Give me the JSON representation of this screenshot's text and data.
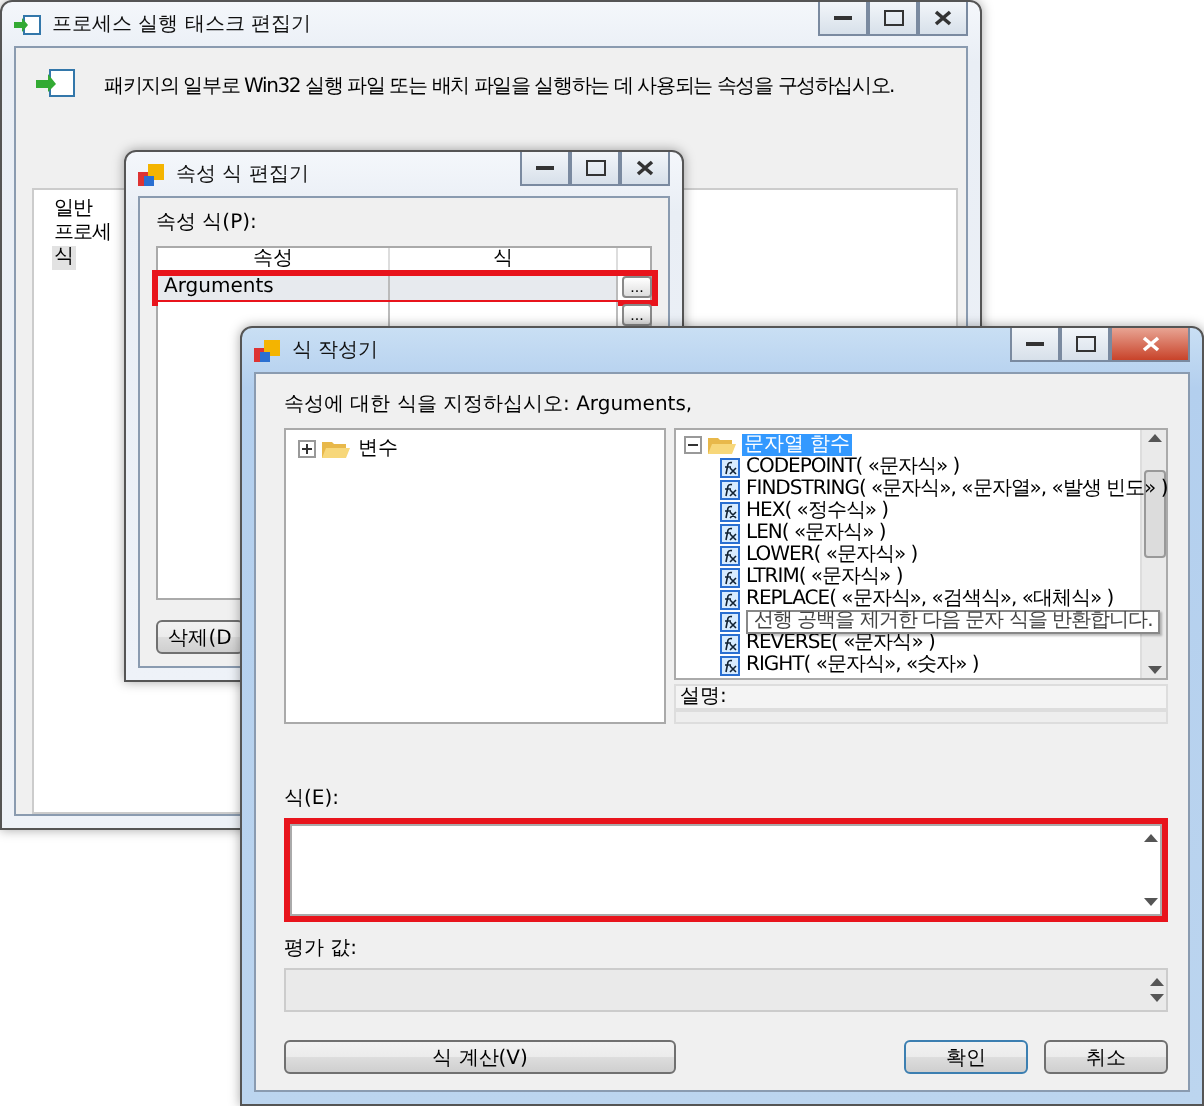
{
  "task_editor": {
    "title": "프로세스 실행 태스크 편집기",
    "description": "패키지의 일부로 Win32 실행 파일 또는 배치 파일을 실행하는 데 사용되는 속성을 구성하십시오.",
    "nav_items": [
      {
        "label": "일반",
        "selected": false
      },
      {
        "label": "프로세",
        "selected": false
      },
      {
        "label": "식",
        "selected": true
      }
    ]
  },
  "property_editor": {
    "title": "속성 식 편집기",
    "grid_label": "속성 식(P):",
    "columns": [
      "속성",
      "식"
    ],
    "rows": [
      {
        "property": "Arguments",
        "button": "...",
        "highlighted": true
      },
      {
        "button": "...",
        "highlighted": false
      }
    ],
    "delete_button": "삭제(D"
  },
  "expression_builder": {
    "title": "식 작성기",
    "prompt": "속성에 대한 식을 지정하십시오: Arguments,",
    "left_tree": [
      {
        "label": "변수",
        "expanded": false,
        "selected": false
      }
    ],
    "right_tree": [
      {
        "label": "문자열 함수",
        "expanded": true,
        "selected": true,
        "children": [
          {
            "label": "CODEPOINT( «문자식» )"
          },
          {
            "label": "FINDSTRING( «문자식», «문자열», «발생 빈도» )"
          },
          {
            "label": "HEX( «정수식» )"
          },
          {
            "label": "LEN( «문자식» )"
          },
          {
            "label": "LOWER( «문자식» )"
          },
          {
            "label": "LTRIM( «문자식» )"
          },
          {
            "label": "REPLACE( «문자식», «검색식», «대체식» )"
          },
          {
            "tooltip": "선행 공백을 제거한 다음 문자 식을 반환합니다."
          },
          {
            "label": "REVERSE( «문자식» )"
          },
          {
            "label": "RIGHT( «문자식», «숫자» )"
          }
        ]
      }
    ],
    "description_label": "설명:",
    "expression_label": "식(E):",
    "expression_highlighted": true,
    "result_label": "평가 값:",
    "buttons": [
      {
        "label": "식 계산(V)",
        "kind": "evaluate"
      },
      {
        "label": "확인",
        "kind": "default"
      },
      {
        "label": "취소",
        "kind": "normal"
      }
    ]
  }
}
